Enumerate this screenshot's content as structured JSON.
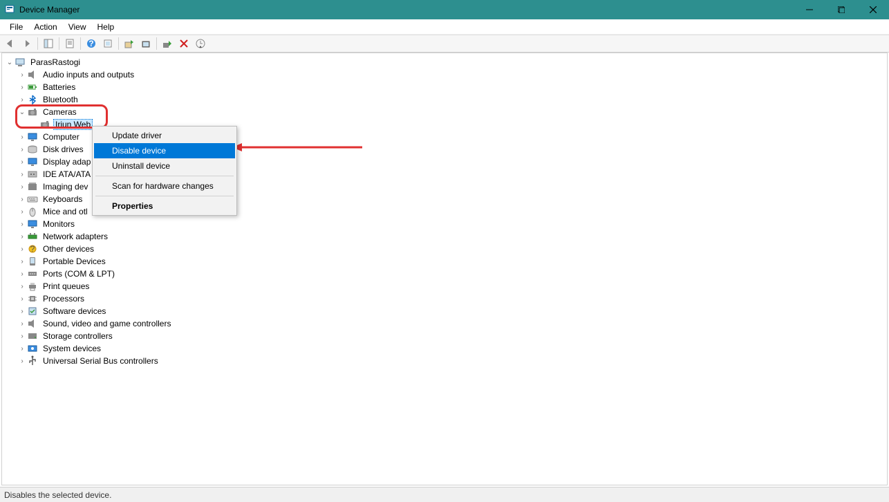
{
  "window": {
    "title": "Device Manager"
  },
  "menubar": {
    "items": [
      "File",
      "Action",
      "View",
      "Help"
    ]
  },
  "tree": {
    "root": "ParasRastogi",
    "categories": [
      {
        "label": "Audio inputs and outputs",
        "icon": "speaker"
      },
      {
        "label": "Batteries",
        "icon": "battery"
      },
      {
        "label": "Bluetooth",
        "icon": "bluetooth"
      },
      {
        "label": "Cameras",
        "icon": "camera",
        "expanded": true,
        "children": [
          {
            "label": "Iriun Web",
            "icon": "camera",
            "selected": true
          }
        ]
      },
      {
        "label": "Computer",
        "icon": "monitor"
      },
      {
        "label": "Disk drives",
        "icon": "disk"
      },
      {
        "label": "Display adap",
        "icon": "monitor"
      },
      {
        "label": "IDE ATA/ATA",
        "icon": "ide"
      },
      {
        "label": "Imaging dev",
        "icon": "imaging"
      },
      {
        "label": "Keyboards",
        "icon": "keyboard"
      },
      {
        "label": "Mice and otl",
        "icon": "mouse"
      },
      {
        "label": "Monitors",
        "icon": "monitor"
      },
      {
        "label": "Network adapters",
        "icon": "network"
      },
      {
        "label": "Other devices",
        "icon": "other"
      },
      {
        "label": "Portable Devices",
        "icon": "portable"
      },
      {
        "label": "Ports (COM & LPT)",
        "icon": "port"
      },
      {
        "label": "Print queues",
        "icon": "printer"
      },
      {
        "label": "Processors",
        "icon": "cpu"
      },
      {
        "label": "Software devices",
        "icon": "software"
      },
      {
        "label": "Sound, video and game controllers",
        "icon": "speaker"
      },
      {
        "label": "Storage controllers",
        "icon": "storage"
      },
      {
        "label": "System devices",
        "icon": "system"
      },
      {
        "label": "Universal Serial Bus controllers",
        "icon": "usb"
      }
    ]
  },
  "context_menu": {
    "items": [
      {
        "label": "Update driver"
      },
      {
        "label": "Disable device",
        "highlighted": true
      },
      {
        "label": "Uninstall device"
      },
      {
        "sep": true
      },
      {
        "label": "Scan for hardware changes"
      },
      {
        "sep": true
      },
      {
        "label": "Properties",
        "bold": true
      }
    ]
  },
  "statusbar": {
    "text": "Disables the selected device."
  }
}
